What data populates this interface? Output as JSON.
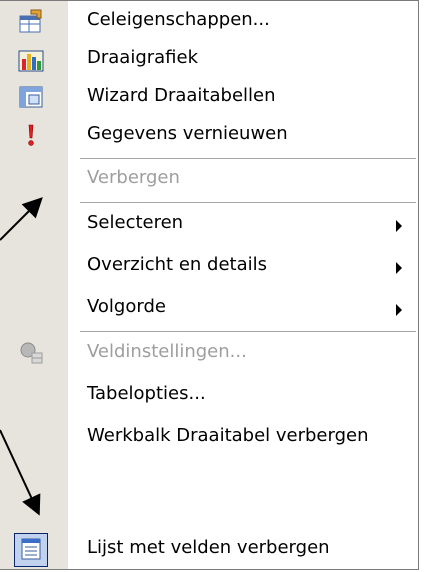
{
  "menu": {
    "items": [
      {
        "label": "Celeigenschappen...",
        "icon": "cell-properties-icon",
        "disabled": false,
        "submenu": false
      },
      {
        "label": "Draaigrafiek",
        "icon": "pivot-chart-icon",
        "disabled": false,
        "submenu": false
      },
      {
        "label": "Wizard Draaitabellen",
        "icon": "pivot-wizard-icon",
        "disabled": false,
        "submenu": false
      },
      {
        "label": "Gegevens vernieuwen",
        "icon": "refresh-data-icon",
        "disabled": false,
        "submenu": false
      },
      {
        "label": "Verbergen",
        "icon": "",
        "disabled": true,
        "submenu": false
      },
      {
        "label": "Selecteren",
        "icon": "",
        "disabled": false,
        "submenu": true
      },
      {
        "label": "Overzicht en details",
        "icon": "",
        "disabled": false,
        "submenu": true
      },
      {
        "label": "Volgorde",
        "icon": "",
        "disabled": false,
        "submenu": true
      },
      {
        "label": "Veldinstellingen...",
        "icon": "field-settings-icon",
        "disabled": true,
        "submenu": false
      },
      {
        "label": "Tabelopties...",
        "icon": "",
        "disabled": false,
        "submenu": false
      },
      {
        "label": "Werkbalk Draaitabel verbergen",
        "icon": "",
        "disabled": false,
        "submenu": false
      },
      {
        "label": "Lijst met velden verbergen",
        "icon": "field-list-icon",
        "disabled": false,
        "submenu": false
      }
    ]
  },
  "colors": {
    "gutter": "#e6e4dc",
    "disabled_text": "#9e9e9e",
    "highlight": "#c1d2ee",
    "highlight_border": "#0a246a"
  }
}
